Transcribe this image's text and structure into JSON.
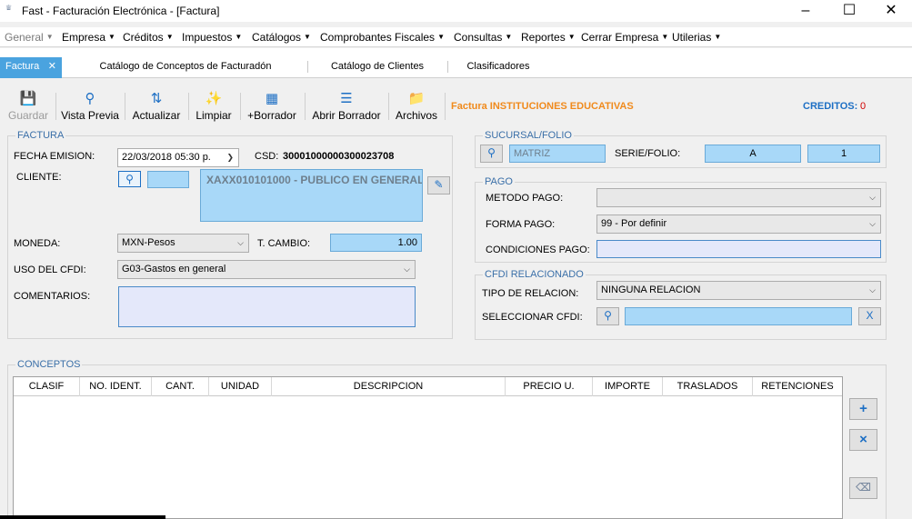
{
  "window": {
    "title": "Fast - Facturación Electrónica - [Factura]",
    "app_icon_text": "FAST",
    "minimize_icon": "minimize-icon",
    "maximize_icon": "maximize-icon",
    "close_icon": "close-icon"
  },
  "menu": [
    {
      "label": "General",
      "disabled": true
    },
    {
      "label": "Empresa"
    },
    {
      "label": "Créditos"
    },
    {
      "label": "Impuestos"
    },
    {
      "label": "Catálogos"
    },
    {
      "label": "Comprobantes Fiscales"
    },
    {
      "label": "Consultas"
    },
    {
      "label": "Reportes"
    },
    {
      "label": "Cerrar Empresa"
    },
    {
      "label": "Utilerias"
    }
  ],
  "tabs": [
    {
      "label": "Factura",
      "active": true
    },
    {
      "label": "Catálogo de Conceptos de Facturadón"
    },
    {
      "label": "Catálogo de Clientes"
    },
    {
      "label": "Clasificadores"
    }
  ],
  "toolbar": {
    "buttons": [
      {
        "label": "Guardar",
        "icon": "save-icon",
        "disabled": true
      },
      {
        "label": "Vista Previa",
        "icon": "preview-icon"
      },
      {
        "label": "Actualizar",
        "icon": "refresh-icon"
      },
      {
        "label": "Limpiar",
        "icon": "clear-icon"
      },
      {
        "label": "+Borrador",
        "icon": "draft-add-icon"
      },
      {
        "label": "Abrir Borrador",
        "icon": "draft-open-icon"
      },
      {
        "label": "Archivos",
        "icon": "folder-icon"
      }
    ],
    "info": "Factura INSTITUCIONES EDUCATIVAS",
    "credits_label": "CREDITOS:",
    "credits_value": "0"
  },
  "factura": {
    "legend": "FACTURA",
    "fecha_label": "FECHA EMISION:",
    "fecha_value": "22/03/2018 05:30 p.",
    "csd_label": "CSD:",
    "csd_value": "30001000000300023708",
    "cliente_label": "CLIENTE:",
    "cliente_code": "",
    "cliente_value": "XAXX010101000 - PUBLICO EN GENERAL",
    "moneda_label": "MONEDA:",
    "moneda_value": "MXN-Pesos",
    "tcambio_label": "T. CAMBIO:",
    "tcambio_value": "1.00",
    "uso_label": "USO DEL CFDI:",
    "uso_value": "G03-Gastos en general",
    "comentarios_label": "COMENTARIOS:",
    "comentarios_value": ""
  },
  "sucursal": {
    "legend": "SUCURSAL/FOLIO",
    "sucursal_value": "MATRIZ",
    "serie_label": "SERIE/FOLIO:",
    "serie_value": "A",
    "folio_value": "1"
  },
  "pago": {
    "legend": "PAGO",
    "metodo_label": "METODO PAGO:",
    "metodo_value": "",
    "forma_label": "FORMA PAGO:",
    "forma_value": "99 - Por definir",
    "condiciones_label": "CONDICIONES PAGO:",
    "condiciones_value": ""
  },
  "cfdi": {
    "legend": "CFDI RELACIONADO",
    "tipo_label": "TIPO DE RELACION:",
    "tipo_value": "NINGUNA RELACION",
    "seleccionar_label": "SELECCIONAR CFDI:",
    "seleccionar_value": "",
    "clear_label": "X"
  },
  "conceptos": {
    "legend": "CONCEPTOS",
    "columns": [
      "CLASIF",
      "NO. IDENT.",
      "CANT.",
      "UNIDAD",
      "DESCRIPCION",
      "PRECIO U.",
      "IMPORTE",
      "TRASLADOS",
      "RETENCIONES"
    ],
    "add_label": "+",
    "remove_label": "×"
  }
}
